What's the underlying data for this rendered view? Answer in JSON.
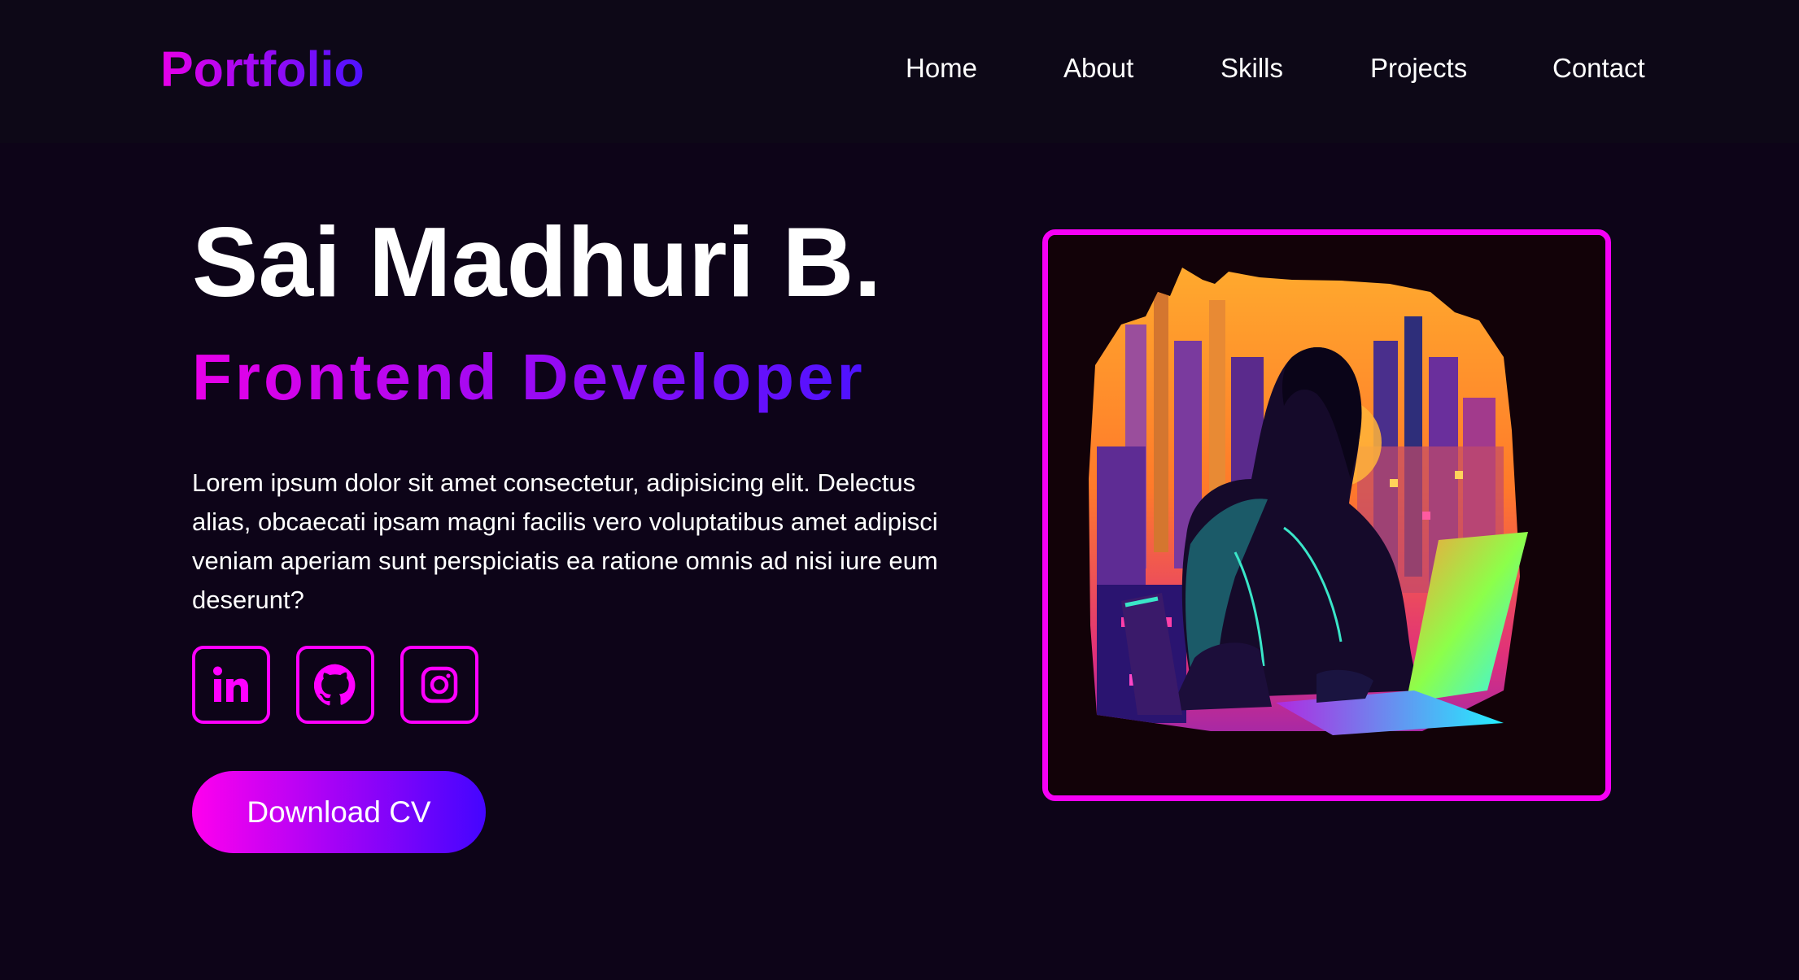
{
  "nav": {
    "logo": "Portfolio",
    "links": [
      {
        "label": "Home"
      },
      {
        "label": "About"
      },
      {
        "label": "Skills"
      },
      {
        "label": "Projects"
      },
      {
        "label": "Contact"
      }
    ]
  },
  "hero": {
    "name": "Sai Madhuri B.",
    "role": "Frontend Developer",
    "description": "Lorem ipsum dolor sit amet consectetur, adipisicing elit. Delectus alias, obcaecati ipsam magni facilis vero voluptatibus amet adipisci veniam aperiam sunt perspiciatis ea ratione omnis ad nisi iure eum deserunt?",
    "cta_label": "Download CV",
    "social": [
      {
        "icon": "linkedin-icon"
      },
      {
        "icon": "github-icon"
      },
      {
        "icon": "instagram-icon"
      }
    ],
    "illustration": "cyberpunk-girl-laptop-illustration"
  },
  "colors": {
    "background": "#0d0418",
    "navbar": "#0d0817",
    "accent_magenta": "#ff00ff",
    "accent_violet": "#4d13ff",
    "text": "#ffffff"
  }
}
